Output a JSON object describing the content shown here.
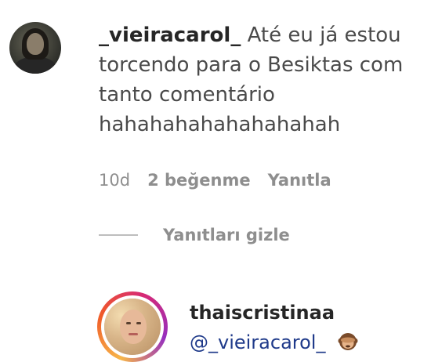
{
  "comment": {
    "username": "_vieiracarol_",
    "text": "Até eu já estou torcendo para o Besiktas com tanto comentário hahahahahahahahahah",
    "meta": {
      "time": "10d",
      "likes": "2 beğenme",
      "reply": "Yanıtla"
    },
    "hide_replies": "Yanıtları gizle"
  },
  "reply": {
    "username": "thaiscristinaa",
    "mention": "@_vieiracarol_",
    "emoji": "see-no-evil-monkey-icon"
  },
  "colors": {
    "text": "#262626",
    "muted": "#8e8e8e",
    "mention": "#1f3a8a"
  }
}
